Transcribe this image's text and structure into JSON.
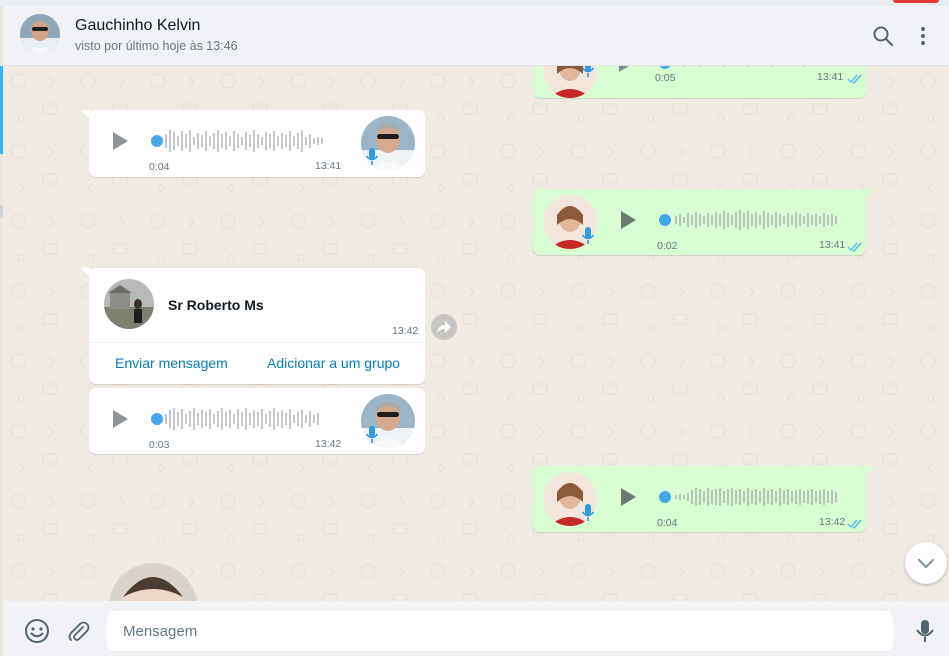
{
  "header": {
    "contact_name": "Gauchinho Kelvin",
    "last_seen": "visto por último hoje às 13:46",
    "icons": [
      "search-icon",
      "menu-dots-icon"
    ]
  },
  "messages": [
    {
      "type": "voice",
      "direction": "out",
      "duration": "0:05",
      "time": "13:41",
      "read": true,
      "partial": true
    },
    {
      "type": "voice",
      "direction": "in",
      "duration": "0:04",
      "time": "13:41"
    },
    {
      "type": "voice",
      "direction": "out",
      "duration": "0:02",
      "time": "13:41",
      "read": true
    },
    {
      "type": "contact",
      "direction": "in",
      "contact_name": "Sr Roberto Ms",
      "time": "13:42",
      "actions": [
        "Enviar mensagem",
        "Adicionar a um grupo"
      ]
    },
    {
      "type": "voice",
      "direction": "in",
      "duration": "0:03",
      "time": "13:42"
    },
    {
      "type": "voice",
      "direction": "out",
      "duration": "0:04",
      "time": "13:42",
      "read": true
    }
  ],
  "composer": {
    "placeholder": "Mensagem",
    "value": "",
    "icons": [
      "emoji-icon",
      "attach-icon",
      "microphone-icon"
    ]
  },
  "colors": {
    "outgoing_bubble": "#d9fdd3",
    "incoming_bubble": "#ffffff",
    "accent_blue": "#34b7f1",
    "read_ticks": "#53bdeb",
    "link": "#027eb5"
  }
}
